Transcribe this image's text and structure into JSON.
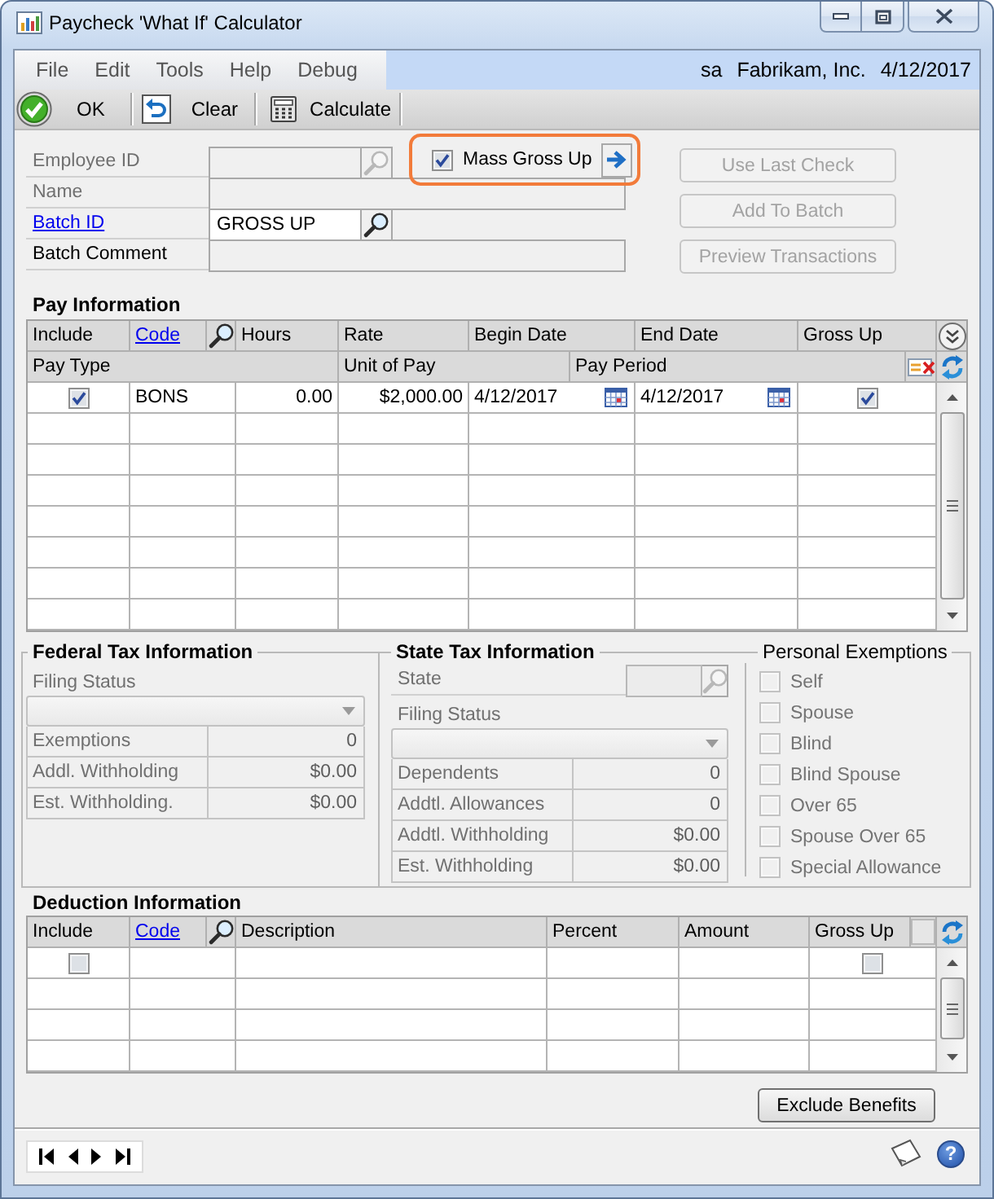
{
  "window": {
    "title": "Paycheck 'What If' Calculator"
  },
  "menu_bar": {
    "items": [
      "File",
      "Edit",
      "Tools",
      "Help",
      "Debug"
    ],
    "user": "sa",
    "company": "Fabrikam, Inc.",
    "date": "4/12/2017"
  },
  "toolbar": [
    {
      "kind": "ok",
      "label": "OK"
    },
    {
      "kind": "clear",
      "label": "Clear"
    },
    {
      "kind": "calculate",
      "label": "Calculate"
    }
  ],
  "header_fields": [
    {
      "label": "Employee ID",
      "link": false,
      "disabled": true,
      "kind": "lookup",
      "editable": false
    },
    {
      "label": "Name",
      "link": false,
      "disabled": true,
      "kind": "text",
      "editable": false
    },
    {
      "label": "Batch ID",
      "link": true,
      "disabled": false,
      "kind": "lookup",
      "editable": true,
      "value": "GROSS UP"
    },
    {
      "label": "Batch Comment",
      "link": false,
      "disabled": false,
      "kind": "text",
      "editable": false
    }
  ],
  "mass_gross_up": {
    "label": "Mass Gross Up",
    "checked": true,
    "highlighted": true
  },
  "action_buttons": [
    {
      "label": "Use Last Check",
      "disabled": true
    },
    {
      "label": "Add To Batch",
      "disabled": true
    },
    {
      "label": "Preview Transactions",
      "disabled": true
    }
  ],
  "pay_information": {
    "title": "Pay Information",
    "columns": [
      {
        "label": "Include",
        "kind": "text"
      },
      {
        "label": "Code",
        "kind": "link"
      },
      {
        "label": "Hours",
        "kind": "text"
      },
      {
        "label": "Rate",
        "kind": "text"
      },
      {
        "label": "Begin Date",
        "kind": "text"
      },
      {
        "label": "End Date",
        "kind": "text"
      },
      {
        "label": "Gross Up",
        "kind": "text"
      }
    ],
    "second_columns": [
      {
        "label": "Pay Type"
      },
      {
        "label": "Unit of Pay"
      },
      {
        "label": "Pay Period"
      }
    ],
    "rows": [
      {
        "include": true,
        "code": "BONS",
        "hours": "0.00",
        "rate": "$2,000.00",
        "begin_date": "4/12/2017",
        "end_date": "4/12/2017",
        "gross_up": true
      }
    ]
  },
  "federal_tax": {
    "title": "Federal Tax Information",
    "disabled": true,
    "filing_status_label": "Filing Status",
    "rows": [
      {
        "label": "Exemptions",
        "value": "0"
      },
      {
        "label": "Addl. Withholding",
        "value": "$0.00"
      },
      {
        "label": "Est. Withholding.",
        "value": "$0.00"
      }
    ]
  },
  "state_tax": {
    "title": "State Tax Information",
    "disabled": true,
    "state_label": "State",
    "filing_status_label": "Filing Status",
    "rows": [
      {
        "label": "Dependents",
        "value": "0"
      },
      {
        "label": "Addtl. Allowances",
        "value": "0"
      },
      {
        "label": "Addtl. Withholding",
        "value": "$0.00"
      },
      {
        "label": "Est. Withholding",
        "value": "$0.00"
      }
    ]
  },
  "personal_exemptions": {
    "title": "Personal Exemptions",
    "items": [
      {
        "label": "Self",
        "checked": false,
        "disabled": true
      },
      {
        "label": "Spouse",
        "checked": false,
        "disabled": true
      },
      {
        "label": "Blind",
        "checked": false,
        "disabled": true
      },
      {
        "label": "Blind Spouse",
        "checked": false,
        "disabled": true
      },
      {
        "label": "Over 65",
        "checked": false,
        "disabled": true
      },
      {
        "label": "Spouse Over 65",
        "checked": false,
        "disabled": true
      },
      {
        "label": "Special Allowance",
        "checked": false,
        "disabled": true
      }
    ]
  },
  "deduction_information": {
    "title": "Deduction Information",
    "columns": [
      {
        "label": "Include",
        "kind": "text"
      },
      {
        "label": "Code",
        "kind": "link"
      },
      {
        "label": "Description",
        "kind": "text"
      },
      {
        "label": "Percent",
        "kind": "text"
      },
      {
        "label": "Amount",
        "kind": "text"
      },
      {
        "label": "Gross Up",
        "kind": "text"
      }
    ],
    "rows": [
      {
        "include": false,
        "gross_up": false
      }
    ]
  },
  "exclude_benefits_button": {
    "label": "Exclude Benefits"
  },
  "footer": {
    "help": "?"
  }
}
